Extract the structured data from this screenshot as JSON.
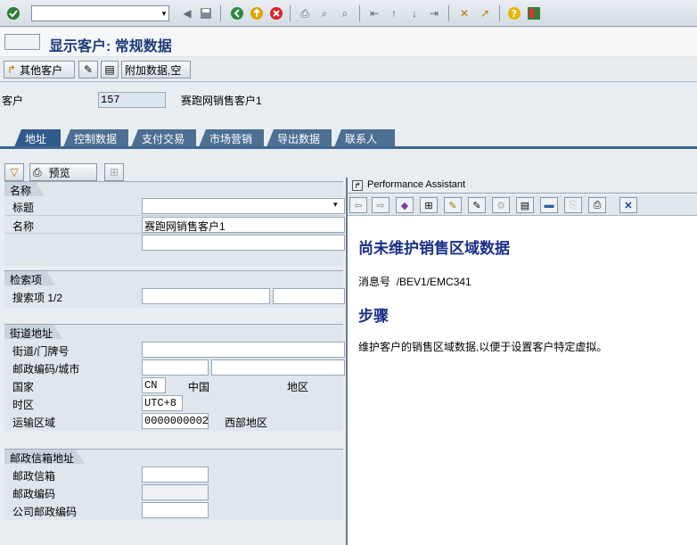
{
  "page_title": "显示客户: 常规数据",
  "app_toolbar": {
    "other_customer": "其他客户",
    "additional_data": "附加数据,空"
  },
  "customer": {
    "label": "客户",
    "number": "157",
    "name": "赛跑网销售客户1"
  },
  "tabs": [
    "地址",
    "控制数据",
    "支付交易",
    "市场营销",
    "导出数据",
    "联系人"
  ],
  "preview_label": "预览",
  "groups": {
    "name": {
      "title": "名称",
      "rows": [
        {
          "label": "标题",
          "value": ""
        },
        {
          "label": "名称",
          "value": "赛跑网销售客户1"
        }
      ]
    },
    "search": {
      "title": "检索项",
      "label": "搜索项 1/2"
    },
    "street": {
      "title": "街道地址",
      "street_label": "街道/门牌号",
      "postal_label": "邮政编码/城市",
      "country_label": "国家",
      "country_code": "CN",
      "country_name": "中国",
      "region_label": "地区",
      "timezone_label": "时区",
      "timezone": "UTC+8",
      "transport_label": "运输区域",
      "transport_code": "0000000002",
      "transport_name": "西部地区"
    },
    "pobox": {
      "title": "邮政信箱地址",
      "pobox_label": "邮政信箱",
      "postal_label": "邮政编码",
      "company_postal_label": "公司邮政编码"
    }
  },
  "pa": {
    "window_title": "Performance Assistant",
    "heading": "尚未维护销售区域数据",
    "message_label": "消息号",
    "message_id": "/BEV1/EMC341",
    "steps": "步骤",
    "body": "维护客户的销售区域数据,以便于设置客户特定虚拟。"
  }
}
